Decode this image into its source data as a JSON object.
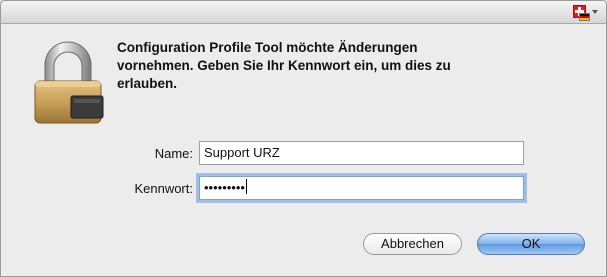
{
  "input_menu": {
    "icon": "swiss-german-input-source-icon"
  },
  "message": {
    "lines": [
      "Configuration Profile Tool möchte Änderungen",
      "vornehmen. Geben Sie Ihr Kennwort ein, um dies zu",
      "erlauben."
    ]
  },
  "form": {
    "name_label": "Name:",
    "name_value": "Support URZ",
    "password_label": "Kennwort:",
    "password_value": "•••••••••"
  },
  "buttons": {
    "cancel": "Abbrechen",
    "ok": "OK"
  },
  "colors": {
    "dialog_bg": "#ececec",
    "primary_button": "#6aa2e4",
    "focus_ring": "#6297dc"
  }
}
